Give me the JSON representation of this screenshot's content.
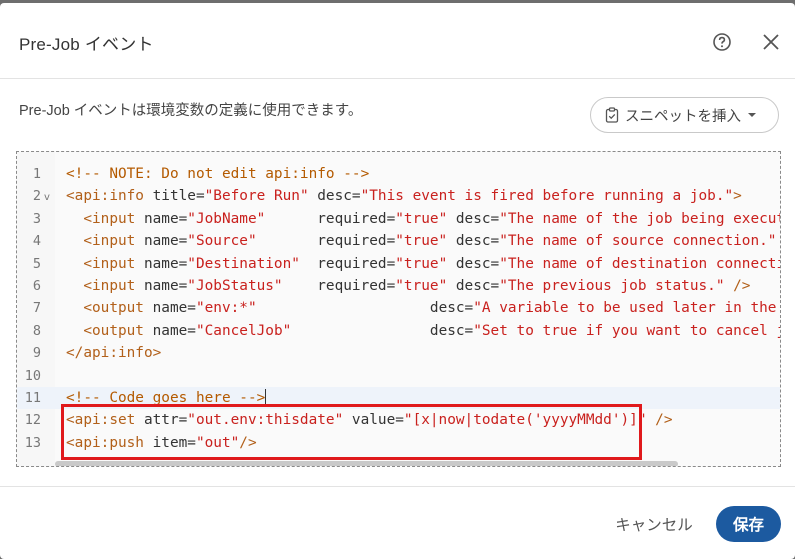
{
  "dialog": {
    "title": "Pre-Job イベント",
    "description": "Pre-Job イベントは環境変数の定義に使用できます。",
    "snippet_button_label": "スニペットを挿入",
    "cancel_label": "キャンセル",
    "save_label": "保存",
    "icons": {
      "help": "help-circle-icon",
      "close": "close-icon",
      "snippet": "clipboard-icon",
      "dropdown": "caret-down-icon",
      "fold": "chevron-down-icon"
    }
  },
  "colors": {
    "primary": "#1c5aa0",
    "highlight_border": "#e0191c",
    "comment": "#b45a00",
    "tag": "#b2601a",
    "string": "#c9211e"
  },
  "editor": {
    "lines": [
      {
        "num": "1",
        "tokens": [
          {
            "t": "comment",
            "v": "<!-- NOTE: Do not edit api:info -->"
          }
        ]
      },
      {
        "num": "2",
        "fold": "v",
        "tokens": [
          {
            "t": "tag",
            "v": "<api:info"
          },
          {
            "t": "attr",
            "v": " title="
          },
          {
            "t": "value",
            "v": "\"Before Run\""
          },
          {
            "t": "attr",
            "v": " desc="
          },
          {
            "t": "value",
            "v": "\"This event is fired before running a job.\""
          },
          {
            "t": "tag",
            "v": ">"
          }
        ]
      },
      {
        "num": "3",
        "tokens": [
          {
            "t": "attr",
            "v": "  "
          },
          {
            "t": "tag",
            "v": "<input"
          },
          {
            "t": "attr",
            "v": " name="
          },
          {
            "t": "value",
            "v": "\"JobName\""
          },
          {
            "t": "attr",
            "v": "      required="
          },
          {
            "t": "value",
            "v": "\"true\""
          },
          {
            "t": "attr",
            "v": " desc="
          },
          {
            "t": "value",
            "v": "\"The name of the job being executed.\""
          },
          {
            "t": "tag",
            "v": " />"
          }
        ]
      },
      {
        "num": "4",
        "tokens": [
          {
            "t": "attr",
            "v": "  "
          },
          {
            "t": "tag",
            "v": "<input"
          },
          {
            "t": "attr",
            "v": " name="
          },
          {
            "t": "value",
            "v": "\"Source\""
          },
          {
            "t": "attr",
            "v": "       required="
          },
          {
            "t": "value",
            "v": "\"true\""
          },
          {
            "t": "attr",
            "v": " desc="
          },
          {
            "t": "value",
            "v": "\"The name of source connection.\""
          },
          {
            "t": "tag",
            "v": " />"
          }
        ]
      },
      {
        "num": "5",
        "tokens": [
          {
            "t": "attr",
            "v": "  "
          },
          {
            "t": "tag",
            "v": "<input"
          },
          {
            "t": "attr",
            "v": " name="
          },
          {
            "t": "value",
            "v": "\"Destination\""
          },
          {
            "t": "attr",
            "v": "  required="
          },
          {
            "t": "value",
            "v": "\"true\""
          },
          {
            "t": "attr",
            "v": " desc="
          },
          {
            "t": "value",
            "v": "\"The name of destination connection.\""
          },
          {
            "t": "tag",
            "v": " />"
          }
        ]
      },
      {
        "num": "6",
        "tokens": [
          {
            "t": "attr",
            "v": "  "
          },
          {
            "t": "tag",
            "v": "<input"
          },
          {
            "t": "attr",
            "v": " name="
          },
          {
            "t": "value",
            "v": "\"JobStatus\""
          },
          {
            "t": "attr",
            "v": "    required="
          },
          {
            "t": "value",
            "v": "\"true\""
          },
          {
            "t": "attr",
            "v": " desc="
          },
          {
            "t": "value",
            "v": "\"The previous job status.\""
          },
          {
            "t": "tag",
            "v": " />"
          }
        ]
      },
      {
        "num": "7",
        "tokens": [
          {
            "t": "attr",
            "v": "  "
          },
          {
            "t": "tag",
            "v": "<output"
          },
          {
            "t": "attr",
            "v": " name="
          },
          {
            "t": "value",
            "v": "\"env:*\""
          },
          {
            "t": "attr",
            "v": "                    desc="
          },
          {
            "t": "value",
            "v": "\"A variable to be used later in the Job"
          }
        ]
      },
      {
        "num": "8",
        "tokens": [
          {
            "t": "attr",
            "v": "  "
          },
          {
            "t": "tag",
            "v": "<output"
          },
          {
            "t": "attr",
            "v": " name="
          },
          {
            "t": "value",
            "v": "\"CancelJob\""
          },
          {
            "t": "attr",
            "v": "                desc="
          },
          {
            "t": "value",
            "v": "\"Set to true if you want to cancel job e"
          }
        ]
      },
      {
        "num": "9",
        "tokens": [
          {
            "t": "tag",
            "v": "</api:info>"
          }
        ]
      },
      {
        "num": "10",
        "tokens": []
      },
      {
        "num": "11",
        "active": true,
        "cursor": true,
        "tokens": [
          {
            "t": "comment",
            "v": "<!-- Code goes here -->"
          }
        ]
      },
      {
        "num": "12",
        "tokens": [
          {
            "t": "tag",
            "v": "<api:set"
          },
          {
            "t": "attr",
            "v": " attr="
          },
          {
            "t": "value",
            "v": "\"out.env:thisdate\""
          },
          {
            "t": "attr",
            "v": " value="
          },
          {
            "t": "value",
            "v": "\"[x|now|todate('yyyyMMdd')]\""
          },
          {
            "t": "tag",
            "v": " />"
          }
        ]
      },
      {
        "num": "13",
        "tokens": [
          {
            "t": "tag",
            "v": "<api:push"
          },
          {
            "t": "attr",
            "v": " item="
          },
          {
            "t": "value",
            "v": "\"out\""
          },
          {
            "t": "tag",
            "v": "/>"
          }
        ]
      }
    ]
  }
}
